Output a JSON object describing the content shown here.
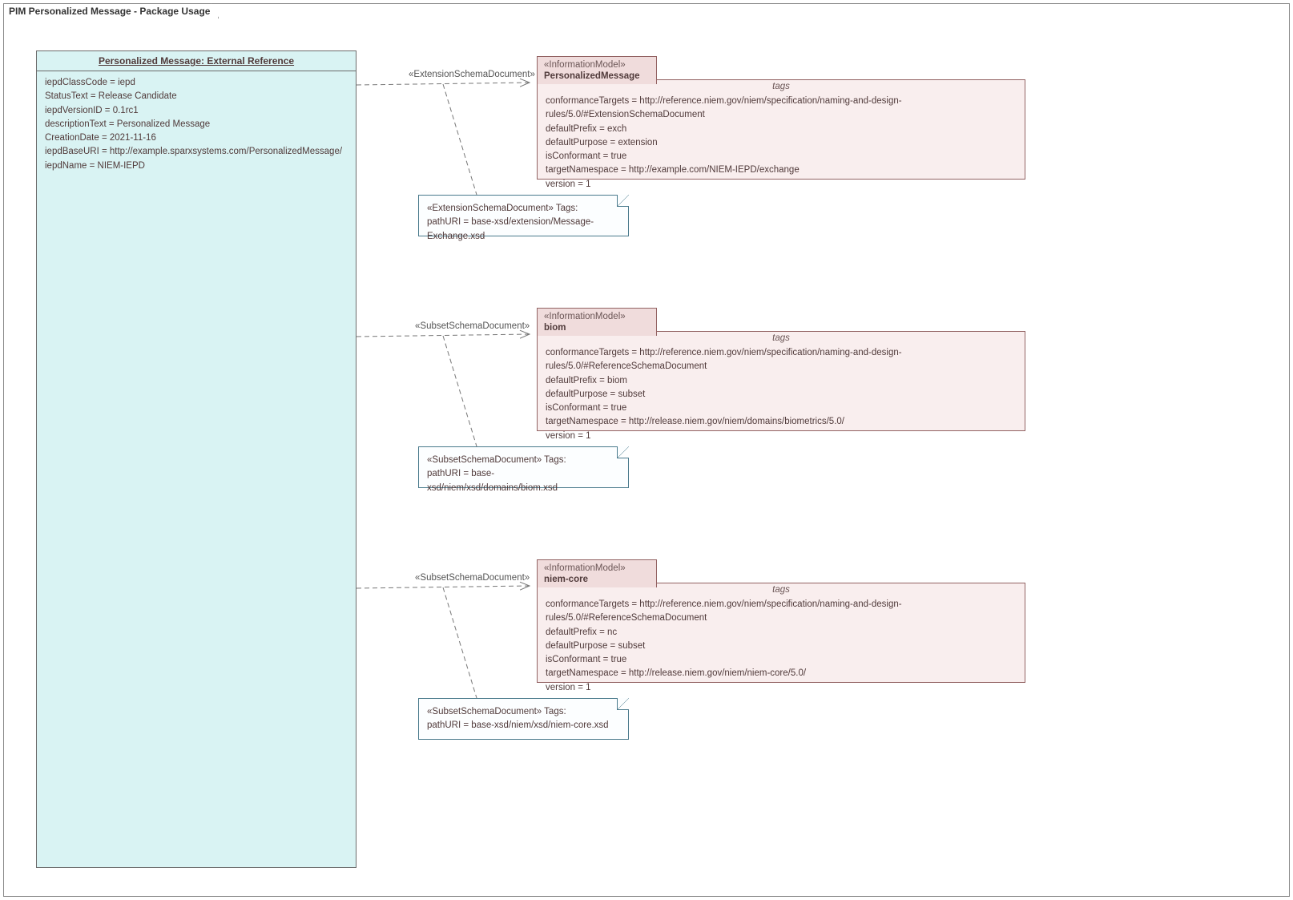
{
  "title": "PIM Personalized Message - Package Usage",
  "externalRef": {
    "header": "Personalized Message: External Reference",
    "props": [
      "iepdClassCode = iepd",
      "StatusText = Release Candidate",
      "iepdVersionID = 0.1rc1",
      "descriptionText = Personalized Message",
      "CreationDate = 2021-11-16",
      "iepdBaseURI = http://example.sparxsystems.com/PersonalizedMessage/",
      "iepdName = NIEM-IEPD"
    ]
  },
  "connectors": [
    {
      "label": "«ExtensionSchemaDocument»"
    },
    {
      "label": "«SubsetSchemaDocument»"
    },
    {
      "label": "«SubsetSchemaDocument»"
    }
  ],
  "notes": [
    {
      "title": "«ExtensionSchemaDocument» Tags:",
      "line": "pathURI = base-xsd/extension/Message-Exchange.xsd"
    },
    {
      "title": "«SubsetSchemaDocument» Tags:",
      "line": "pathURI = base-xsd/niem/xsd/domains/biom.xsd"
    },
    {
      "title": "«SubsetSchemaDocument» Tags:",
      "line": "pathURI = base-xsd/niem/xsd/niem-core.xsd"
    }
  ],
  "packages": [
    {
      "stereo": "«InformationModel»",
      "name": "PersonalizedMessage",
      "tagsTitle": "tags",
      "tags": [
        "conformanceTargets = http://reference.niem.gov/niem/specification/naming-and-design-rules/5.0/#ExtensionSchemaDocument",
        "defaultPrefix = exch",
        "defaultPurpose = extension",
        "isConformant = true",
        "targetNamespace = http://example.com/NIEM-IEPD/exchange",
        "version = 1"
      ]
    },
    {
      "stereo": "«InformationModel»",
      "name": "biom",
      "tagsTitle": "tags",
      "tags": [
        "conformanceTargets = http://reference.niem.gov/niem/specification/naming-and-design-rules/5.0/#ReferenceSchemaDocument",
        "defaultPrefix = biom",
        "defaultPurpose = subset",
        "isConformant = true",
        "targetNamespace = http://release.niem.gov/niem/domains/biometrics/5.0/",
        "version = 1"
      ]
    },
    {
      "stereo": "«InformationModel»",
      "name": "niem-core",
      "tagsTitle": "tags",
      "tags": [
        "conformanceTargets = http://reference.niem.gov/niem/specification/naming-and-design-rules/5.0/#ReferenceSchemaDocument",
        "defaultPrefix = nc",
        "defaultPurpose = subset",
        "isConformant = true",
        "targetNamespace = http://release.niem.gov/niem/niem-core/5.0/",
        "version = 1"
      ]
    }
  ]
}
